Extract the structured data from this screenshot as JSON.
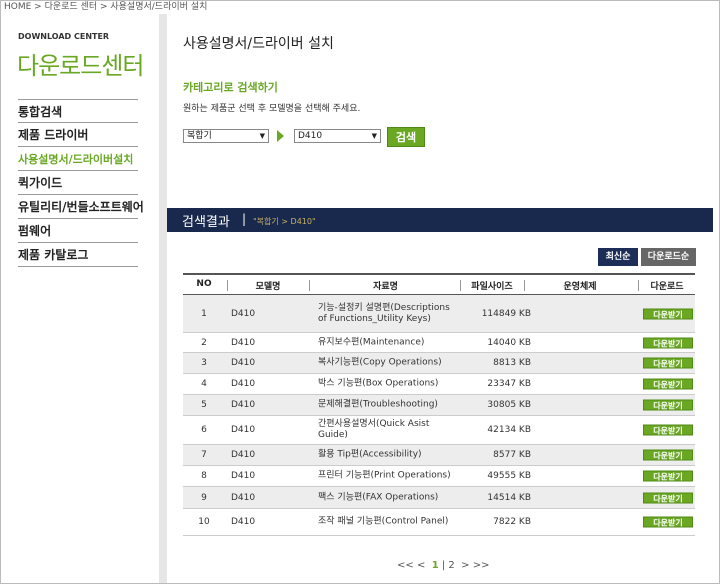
{
  "breadcrumb": "HOME > 다운로드 센터 > 사용설명서/드라이버 설치",
  "sidebar": {
    "small_title": "DOWNLOAD CENTER",
    "big_title": "다운로드센터",
    "items": [
      {
        "label": "통합검색"
      },
      {
        "label": "제품 드라이버"
      },
      {
        "label": "사용설명서/드라이버설치"
      },
      {
        "label": "퀵가이드"
      },
      {
        "label": "유틸리티/번들소프트웨어"
      },
      {
        "label": "펌웨어"
      },
      {
        "label": "제품 카탈로그"
      }
    ]
  },
  "main": {
    "title": "사용설명서/드라이버 설치",
    "category_title": "카테고리로 검색하기",
    "category_desc": "원하는 제품군 선택 후 모델명을 선택해 주세요.",
    "select_category": "복합기",
    "select_model": "D410",
    "search_label": "검색"
  },
  "results": {
    "title": "검색결과",
    "separator": "|",
    "path": "\"복합기 > D410\"",
    "sort_newest": "최신순",
    "sort_downloads": "다운로드순",
    "columns": [
      "NO",
      "모델명",
      "자료명",
      "파일사이즈",
      "운영체제",
      "다운로드"
    ],
    "download_label": "다운받기",
    "rows": [
      {
        "no": "1",
        "model": "D410",
        "doc": "기능-설정키 설명편(Descriptions of Functions_Utility Keys)",
        "size": "114849 KB"
      },
      {
        "no": "2",
        "model": "D410",
        "doc": "유지보수편(Maintenance)",
        "size": "14040 KB"
      },
      {
        "no": "3",
        "model": "D410",
        "doc": "복사기능편(Copy Operations)",
        "size": "8813 KB"
      },
      {
        "no": "4",
        "model": "D410",
        "doc": "박스 기능편(Box Operations)",
        "size": "23347 KB"
      },
      {
        "no": "5",
        "model": "D410",
        "doc": "문제해결편(Troubleshooting)",
        "size": "30805 KB"
      },
      {
        "no": "6",
        "model": "D410",
        "doc": "간편사용설명서(Quick Asist Guide)",
        "size": "42134 KB"
      },
      {
        "no": "7",
        "model": "D410",
        "doc": "활용 Tip편(Accessibility)",
        "size": "8577 KB"
      },
      {
        "no": "8",
        "model": "D410",
        "doc": "프린터 기능편(Print Operations)",
        "size": "49555 KB"
      },
      {
        "no": "9",
        "model": "D410",
        "doc": "팩스 기능편(FAX Operations)",
        "size": "14514 KB"
      },
      {
        "no": "10",
        "model": "D410",
        "doc": "조작 패널 기능편(Control Panel)",
        "size": "7822 KB"
      }
    ]
  },
  "pagination": {
    "first": "<<",
    "prev": "<",
    "pages": [
      "1",
      "2"
    ],
    "separator": "|",
    "next": ">",
    "last": ">>"
  }
}
